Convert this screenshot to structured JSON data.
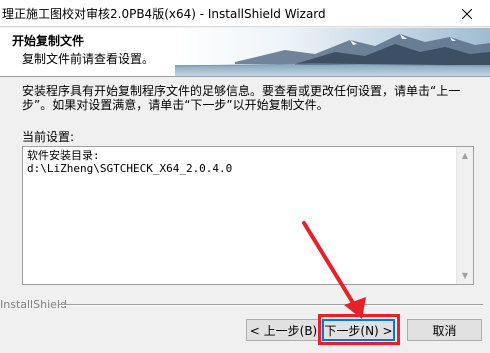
{
  "window": {
    "title": "理正施工图校对审核2.0PB4版(x64) - InstallShield Wizard",
    "close_icon": "close-icon"
  },
  "header": {
    "title": "开始复制文件",
    "subtitle": "复制文件前请查看设置。"
  },
  "body": {
    "description": "安装程序具有开始复制程序文件的足够信息。要查看或更改任何设置，请单击“上一步”。如果对设置满意，请单击“下一步”以开始复制文件。",
    "current_settings_label": "当前设置:"
  },
  "settings": {
    "line1": "软件安装目录:",
    "line2": "d:\\LiZheng\\SGTCHECK_X64_2.0.4.0"
  },
  "footer": {
    "brand": "InstallShield",
    "back_label": "< 上一步(B)",
    "next_label": "下一步(N) >",
    "cancel_label": "取消"
  },
  "colors": {
    "highlight": "#e8202a",
    "focus": "#0078d7"
  }
}
